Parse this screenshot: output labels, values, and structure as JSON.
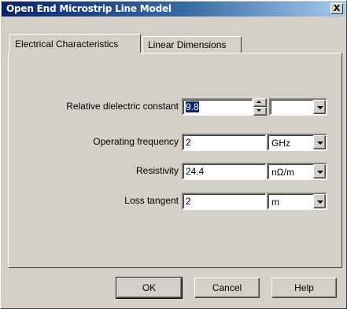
{
  "window": {
    "title": "Open End Microstrip Line Model",
    "close_label": "X"
  },
  "tabs": [
    {
      "label": "Electrical Characteristics",
      "active": true
    },
    {
      "label": "Linear Dimensions",
      "active": false
    }
  ],
  "rows": [
    {
      "label": "Relative dielectric constant",
      "value": "9.8",
      "unit": ""
    },
    {
      "label": "Operating frequency",
      "value": "2",
      "unit": "GHz"
    },
    {
      "label": "Resistivity",
      "value": "24.4",
      "unit": "nΩ/m"
    },
    {
      "label": "Loss tangent",
      "value": "2",
      "unit": "m"
    }
  ],
  "buttons": {
    "ok": "OK",
    "cancel": "Cancel",
    "help": "Help"
  }
}
